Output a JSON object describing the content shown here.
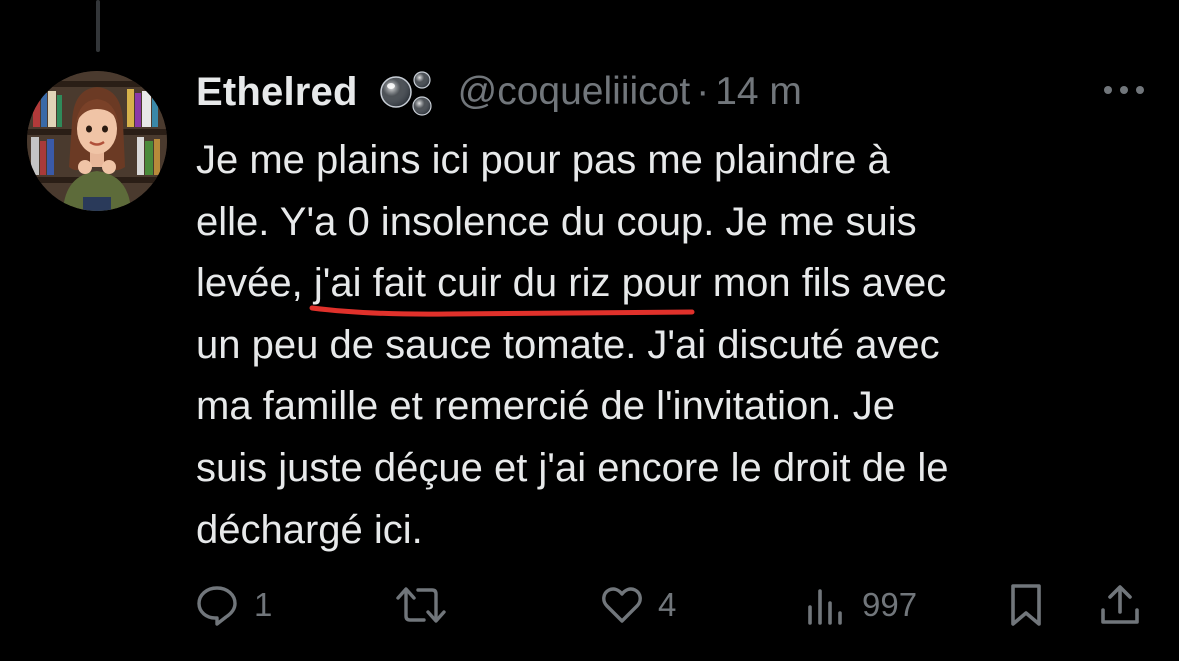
{
  "tweet": {
    "display_name": "Ethelred",
    "name_emoji": "bubbles-icon",
    "handle": "@coqueliiicot",
    "separator": "·",
    "time": "14 m",
    "text": {
      "line1": "Je me plains ici pour pas me plaindre à",
      "line2": "elle. Y'a 0 insolence du coup. Je me suis",
      "line3_pre": "levée, ",
      "line3_highlight": "j'ai fait cuir du riz",
      "line3_post": " pour mon fils avec",
      "line4": "un peu de sauce tomate. J'ai discuté avec",
      "line5": "ma famille et remercié de l'invitation. Je",
      "line6": "suis juste déçue et j'ai encore le droit de le",
      "line7": "déchargé ici."
    },
    "highlight_color": "#e0312b"
  },
  "actions": {
    "reply": {
      "icon": "reply-icon",
      "count": "1"
    },
    "retweet": {
      "icon": "retweet-icon",
      "count": ""
    },
    "like": {
      "icon": "heart-icon",
      "count": "4"
    },
    "views": {
      "icon": "views-icon",
      "count": "997"
    },
    "bookmark": {
      "icon": "bookmark-icon"
    },
    "share": {
      "icon": "share-icon"
    }
  },
  "colors": {
    "background": "#000000",
    "text": "#e7e9ea",
    "muted": "#71767b"
  }
}
